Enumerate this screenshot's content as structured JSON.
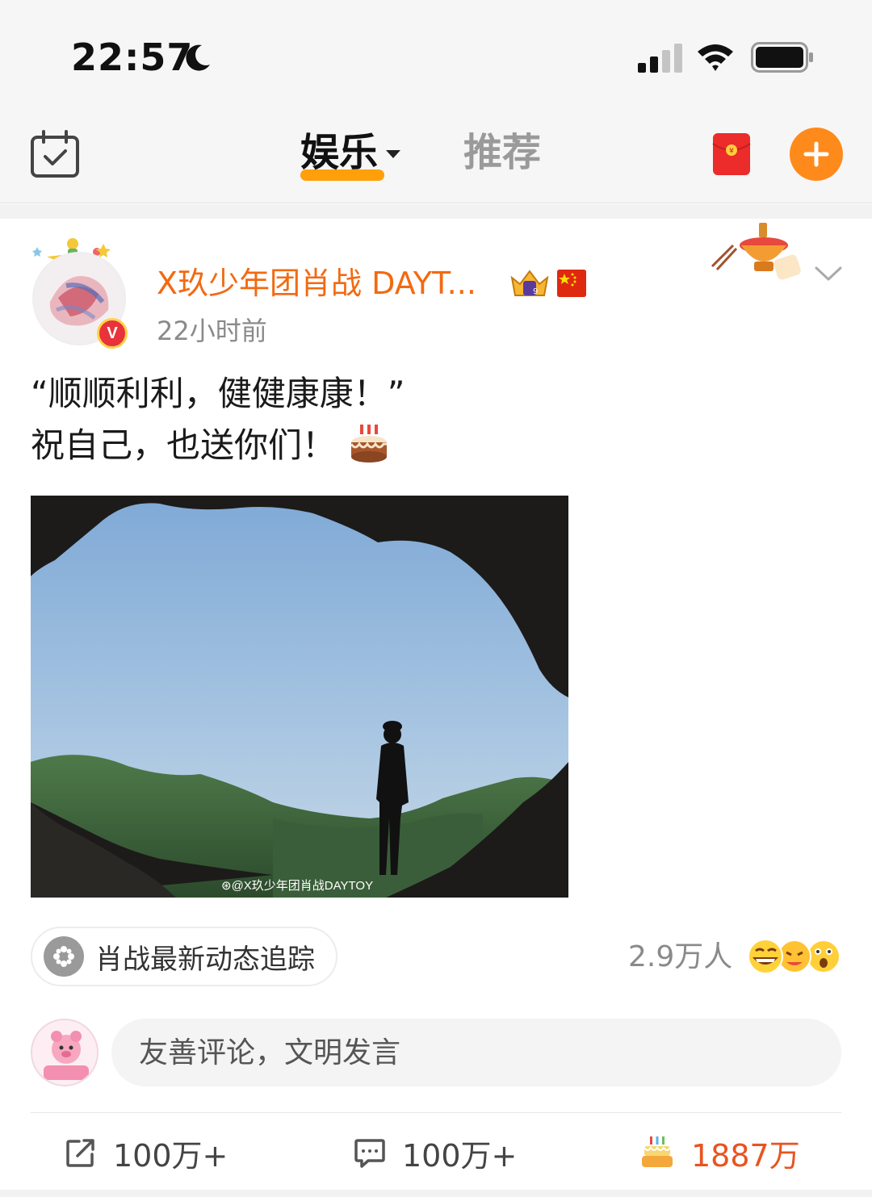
{
  "status_bar": {
    "time": "22:57"
  },
  "nav": {
    "active_tab": "娱乐",
    "other_tab": "推荐",
    "accent_color": "#ff9f0a"
  },
  "post": {
    "username": "X玖少年团肖战 DAYT...",
    "time": "22小时前",
    "text_line1": "“顺顺利利，健健康康！”",
    "text_line2": "祝自己，也送你们！",
    "image_watermark": "@X玖少年团肖战DAYTOY",
    "username_color": "#f26a11"
  },
  "topic": {
    "label": "肖战最新动态追踪",
    "reaction_count": "2.9万人"
  },
  "comment_box": {
    "placeholder": "友善评论，文明发言"
  },
  "actions": {
    "repost": "100万+",
    "comment": "100万+",
    "like": "1887万"
  },
  "icons": [
    "moon-icon",
    "signal-icon",
    "wifi-icon",
    "battery-icon",
    "calendar-check-icon",
    "red-packet-icon",
    "plus-icon",
    "crown-badge-icon",
    "flag-icon",
    "chevron-down-icon",
    "cake-emoji-icon",
    "topic-icon",
    "repost-icon",
    "comment-icon",
    "cake-like-icon"
  ]
}
